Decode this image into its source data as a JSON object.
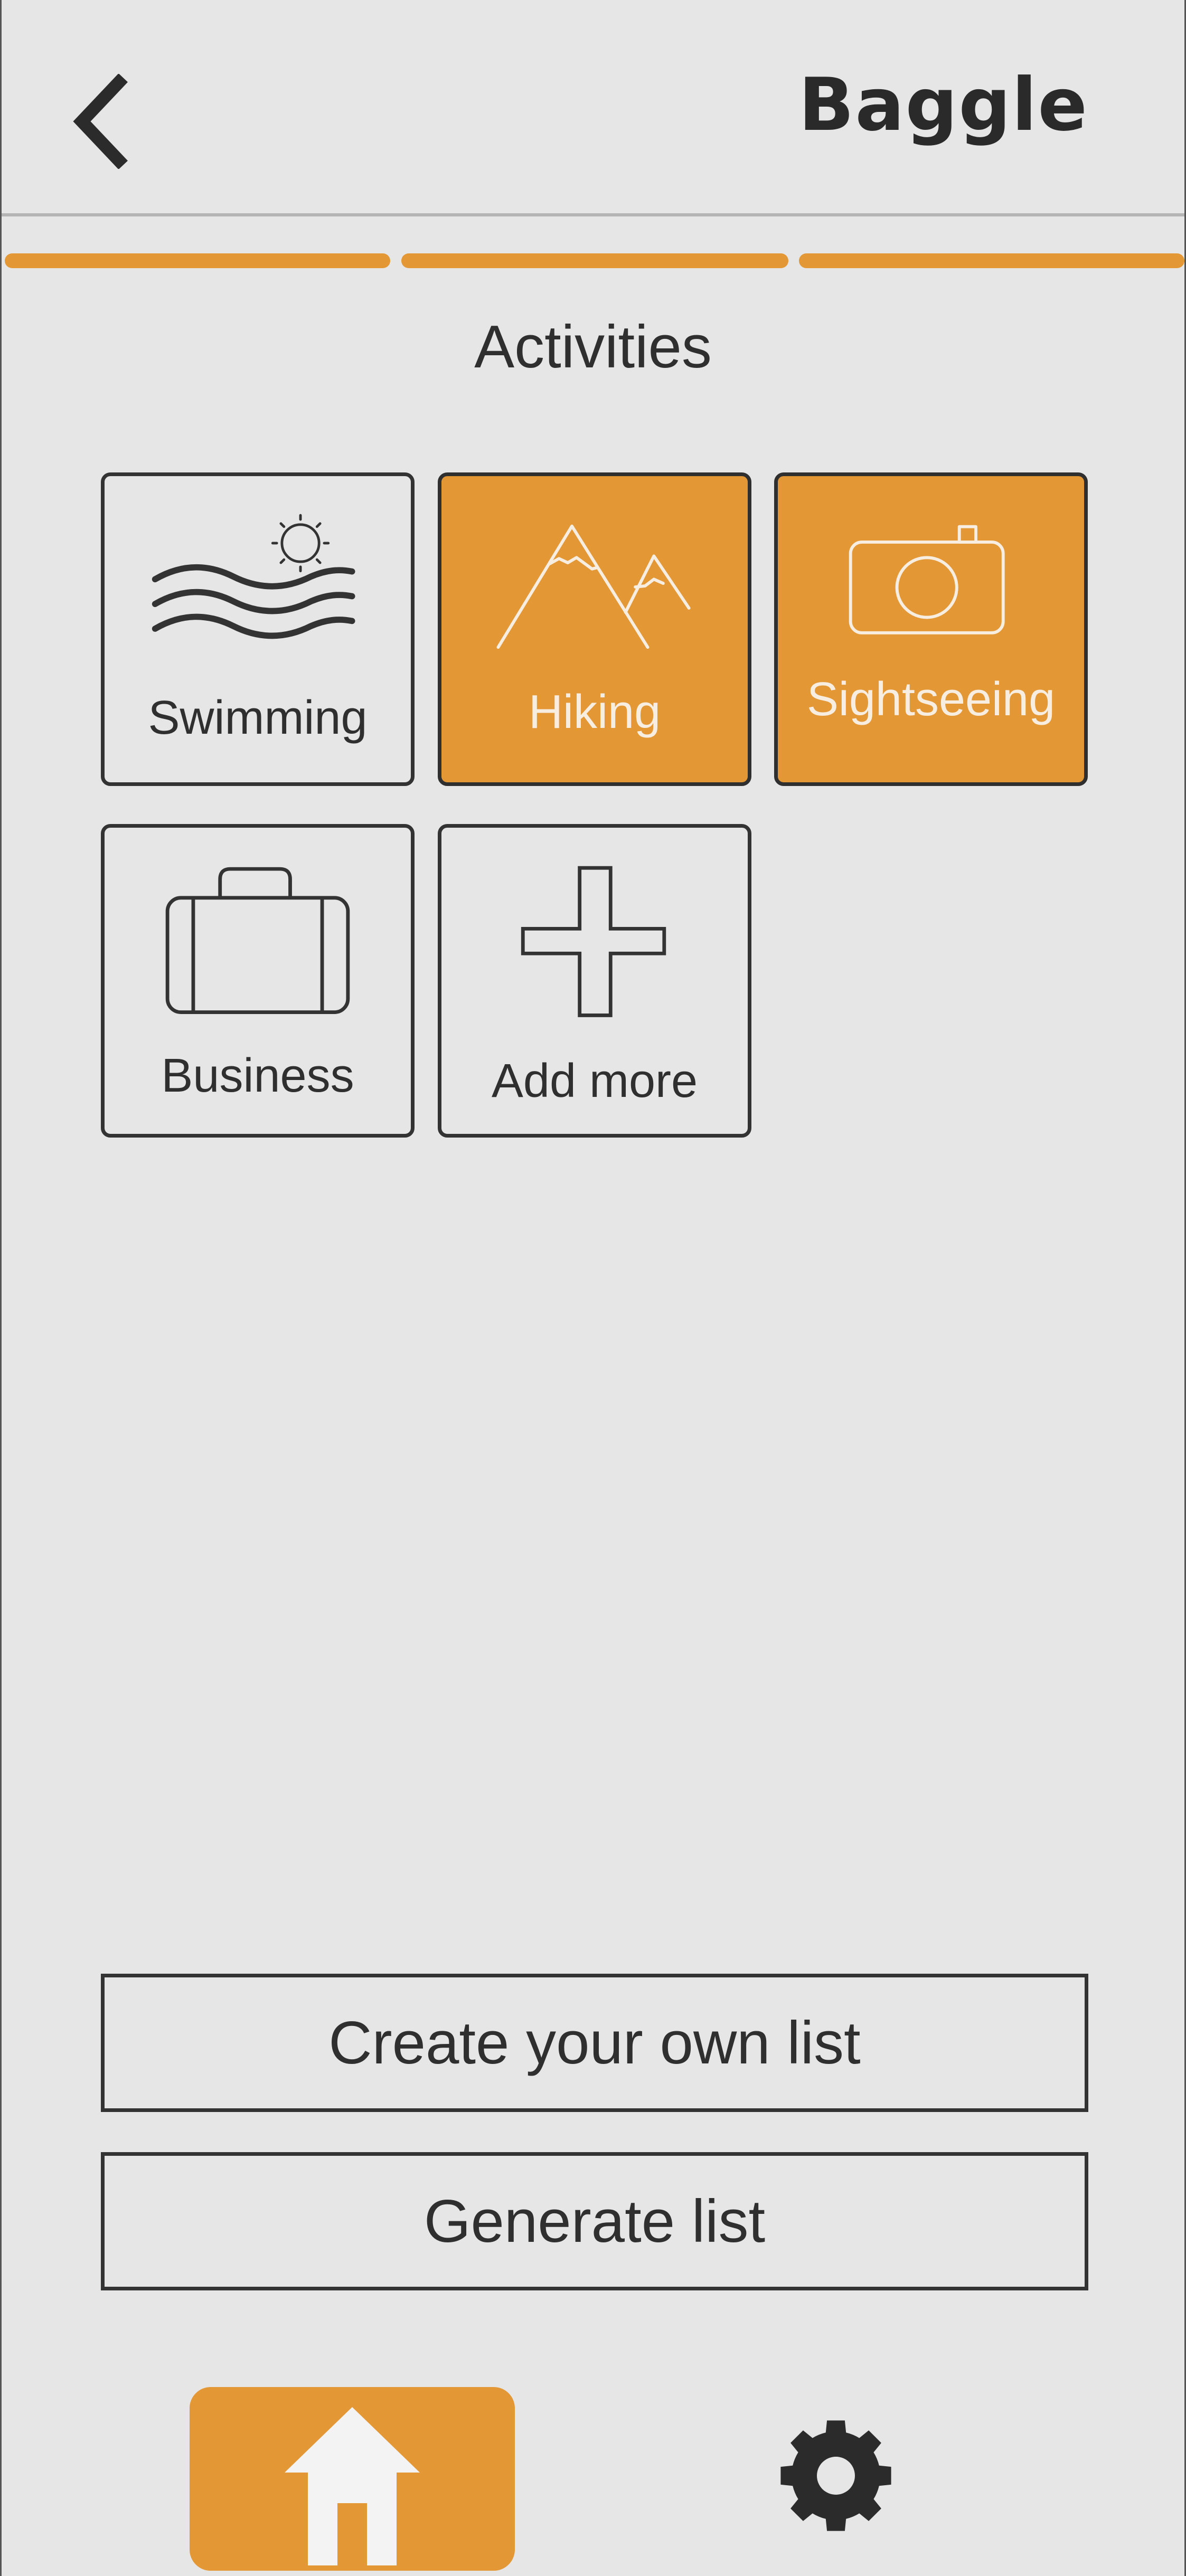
{
  "header": {
    "brand": "Baggle",
    "back_icon": "chevron-left-icon"
  },
  "progress": {
    "steps_total": 3,
    "steps_completed": 3,
    "color": "#e39735"
  },
  "activities": {
    "title": "Activities",
    "items": [
      {
        "label": "Swimming",
        "icon": "waves-sun-icon",
        "selected": false
      },
      {
        "label": "Hiking",
        "icon": "mountains-icon",
        "selected": true
      },
      {
        "label": "Sightseeing",
        "icon": "camera-icon",
        "selected": true
      },
      {
        "label": "Business",
        "icon": "briefcase-icon",
        "selected": false
      },
      {
        "label": "Add more",
        "icon": "plus-icon",
        "selected": false
      }
    ]
  },
  "actions": {
    "create_label": "Create your own list",
    "generate_label": "Generate list"
  },
  "bottom_nav": {
    "home_icon": "home-icon",
    "settings_icon": "gear-icon",
    "active": "home"
  },
  "colors": {
    "accent": "#e39735",
    "background": "#e6e6e6",
    "text": "#2f2f2f"
  }
}
